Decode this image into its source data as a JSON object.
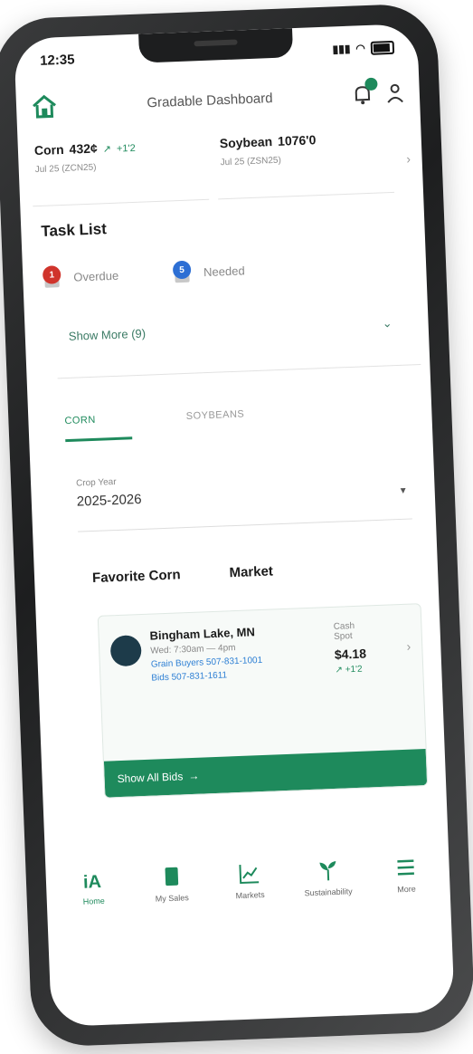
{
  "status": {
    "time": "12:35"
  },
  "header": {
    "title": "Gradable Dashboard"
  },
  "prices": [
    {
      "name": "Corn",
      "price": "432¢",
      "change": "+1'2",
      "contract": "Jul 25 (ZCN25)"
    },
    {
      "name": "Soybean",
      "price": "1076'0",
      "change": "",
      "contract": "Jul 25 (ZSN25)"
    }
  ],
  "tasks": {
    "title": "Task List",
    "items": [
      {
        "label": "Overdue",
        "count": "1",
        "color": "#d0342c"
      },
      {
        "label": "Needed",
        "count": "5",
        "color": "#2d6fd4"
      }
    ],
    "show_more": "Show More (9)"
  },
  "tabs": [
    {
      "label": "CORN"
    },
    {
      "label": "SOYBEANS"
    }
  ],
  "crop_year": {
    "label": "Crop Year",
    "value": "2025-2026"
  },
  "favorites": {
    "left": "Favorite Corn",
    "right": "Market"
  },
  "market": {
    "name": "Bingham Lake, MN",
    "hours": "Wed: 7:30am — 4pm",
    "grain_buyers": "Grain Buyers 507-831-1001",
    "bids": "Bids 507-831-1611",
    "cash_label": "Cash",
    "spot_label": "Spot",
    "price": "$4.18",
    "change": "+1'2",
    "footer": "Show All Bids"
  },
  "nav": [
    {
      "label": "Home",
      "icon": "home-logo-icon"
    },
    {
      "label": "My Sales",
      "icon": "sales-icon"
    },
    {
      "label": "Markets",
      "icon": "markets-chart-icon"
    },
    {
      "label": "Sustainability",
      "icon": "plant-icon"
    },
    {
      "label": "More",
      "icon": "menu-icon"
    }
  ],
  "colors": {
    "brand": "#1e8a5c",
    "link": "#2d7fd4"
  }
}
